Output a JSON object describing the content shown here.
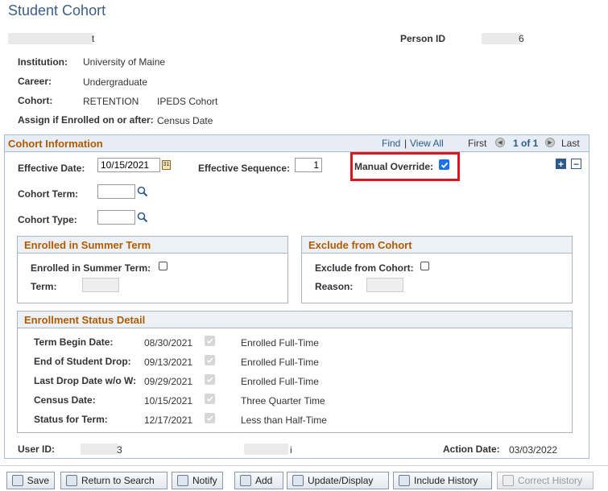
{
  "page": {
    "title": "Student Cohort"
  },
  "header": {
    "name_suffix": "t",
    "person_id_label": "Person ID",
    "person_id_suffix": "6"
  },
  "info": [
    {
      "label": "Institution:",
      "value": "University of Maine"
    },
    {
      "label": "Career:",
      "value": "Undergraduate"
    },
    {
      "label": "Cohort:",
      "value": "RETENTION",
      "value2": "IPEDS Cohort"
    },
    {
      "label": "Assign if Enrolled on or after:",
      "value": "Census Date"
    }
  ],
  "cohort_info": {
    "title": "Cohort Information",
    "find": "Find",
    "sep": "|",
    "view_all": "View All",
    "first": "First",
    "count": "1 of 1",
    "last": "Last",
    "effective_date_label": "Effective Date:",
    "effective_date": "10/15/2021",
    "effective_seq_label": "Effective Sequence:",
    "effective_seq": "1",
    "manual_override_label": "Manual Override:",
    "manual_override_checked": true,
    "cohort_term_label": "Cohort Term:",
    "cohort_term": "",
    "cohort_type_label": "Cohort Type:",
    "cohort_type": ""
  },
  "summer": {
    "title": "Enrolled in Summer Term",
    "checkbox_label": "Enrolled in Summer Term:",
    "term_label": "Term:"
  },
  "exclude": {
    "title": "Exclude from Cohort",
    "checkbox_label": "Exclude from Cohort:",
    "reason_label": "Reason:"
  },
  "enrollment": {
    "title": "Enrollment Status Detail",
    "rows": [
      {
        "label": "Term Begin Date:",
        "date": "08/30/2021",
        "status": "Enrolled Full-Time"
      },
      {
        "label": "End of Student Drop:",
        "date": "09/13/2021",
        "status": "Enrolled Full-Time"
      },
      {
        "label": "Last Drop Date w/o W:",
        "date": "09/29/2021",
        "status": "Enrolled Full-Time"
      },
      {
        "label": "Census Date:",
        "date": "10/15/2021",
        "status": "Three Quarter Time"
      },
      {
        "label": "Status for Term:",
        "date": "12/17/2021",
        "status": "Less than Half-Time"
      }
    ]
  },
  "footer": {
    "user_id_label": "User ID:",
    "user_id_suffix": "3",
    "mid_suffix": "i",
    "action_date_label": "Action Date:",
    "action_date": "03/03/2022"
  },
  "toolbar": {
    "save": "Save",
    "return_to_search": "Return to Search",
    "notify": "Notify",
    "add": "Add",
    "update_display": "Update/Display",
    "include_history": "Include History",
    "correct_history": "Correct History"
  },
  "colors": {
    "title": "#3a5f87",
    "section_header": "#b05a00",
    "link": "#2d5a8a",
    "highlight_box": "#e3141b",
    "checkbox_checked": "#1a73e8"
  }
}
